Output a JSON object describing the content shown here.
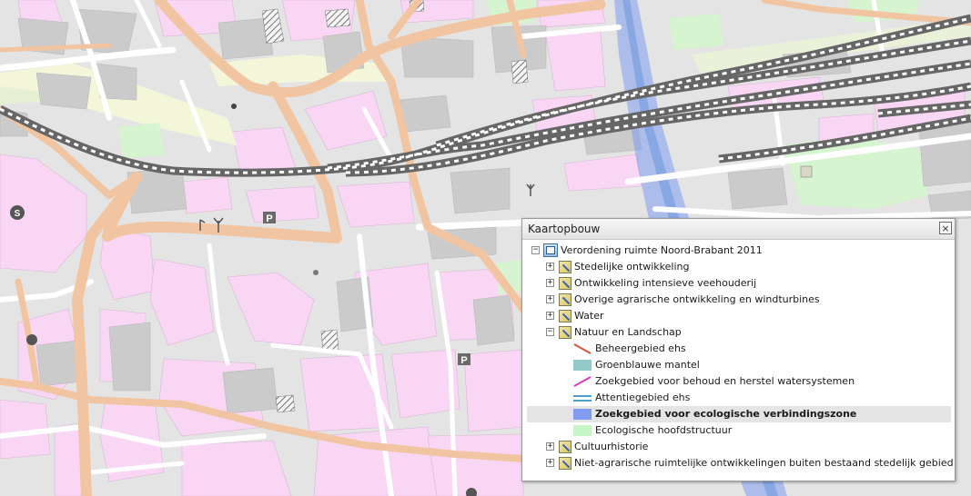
{
  "map": {
    "parking_label": "P",
    "station_label": "S"
  },
  "panel": {
    "title": "Kaartopbouw",
    "close_label": "×",
    "root": {
      "label": "Verordening ruimte Noord-Brabant 2011",
      "expander": "−"
    },
    "groups": [
      {
        "label": "Stedelijke ontwikkeling",
        "expander": "+"
      },
      {
        "label": "Ontwikkeling intensieve veehouderij",
        "expander": "+"
      },
      {
        "label": "Overige agrarische ontwikkeling en windturbines",
        "expander": "+"
      },
      {
        "label": "Water",
        "expander": "+"
      },
      {
        "label": "Natuur en Landschap",
        "expander": "−"
      },
      {
        "label": "Cultuurhistorie",
        "expander": "+"
      },
      {
        "label": "Niet-agrarische ruimtelijke ontwikkelingen buiten bestaand stedelijk gebied",
        "expander": "+"
      }
    ],
    "legend": [
      {
        "label": "Beheergebied ehs",
        "symbol": "diagonal-line",
        "color": "#d0553a"
      },
      {
        "label": "Groenblauwe mantel",
        "symbol": "fill",
        "color": "#93c9c8"
      },
      {
        "label": "Zoekgebied voor behoud en herstel watersystemen",
        "symbol": "diagonal-line",
        "color": "#d63cc0"
      },
      {
        "label": "Attentiegebied ehs",
        "symbol": "double-line",
        "color": "#4aa0c9"
      },
      {
        "label": "Zoekgebied voor ecologische verbindingszone",
        "symbol": "fill",
        "color": "#7f9cf0",
        "selected": true
      },
      {
        "label": "Ecologische hoofdstructuur",
        "symbol": "fill",
        "color": "#c6f5c6"
      }
    ]
  }
}
